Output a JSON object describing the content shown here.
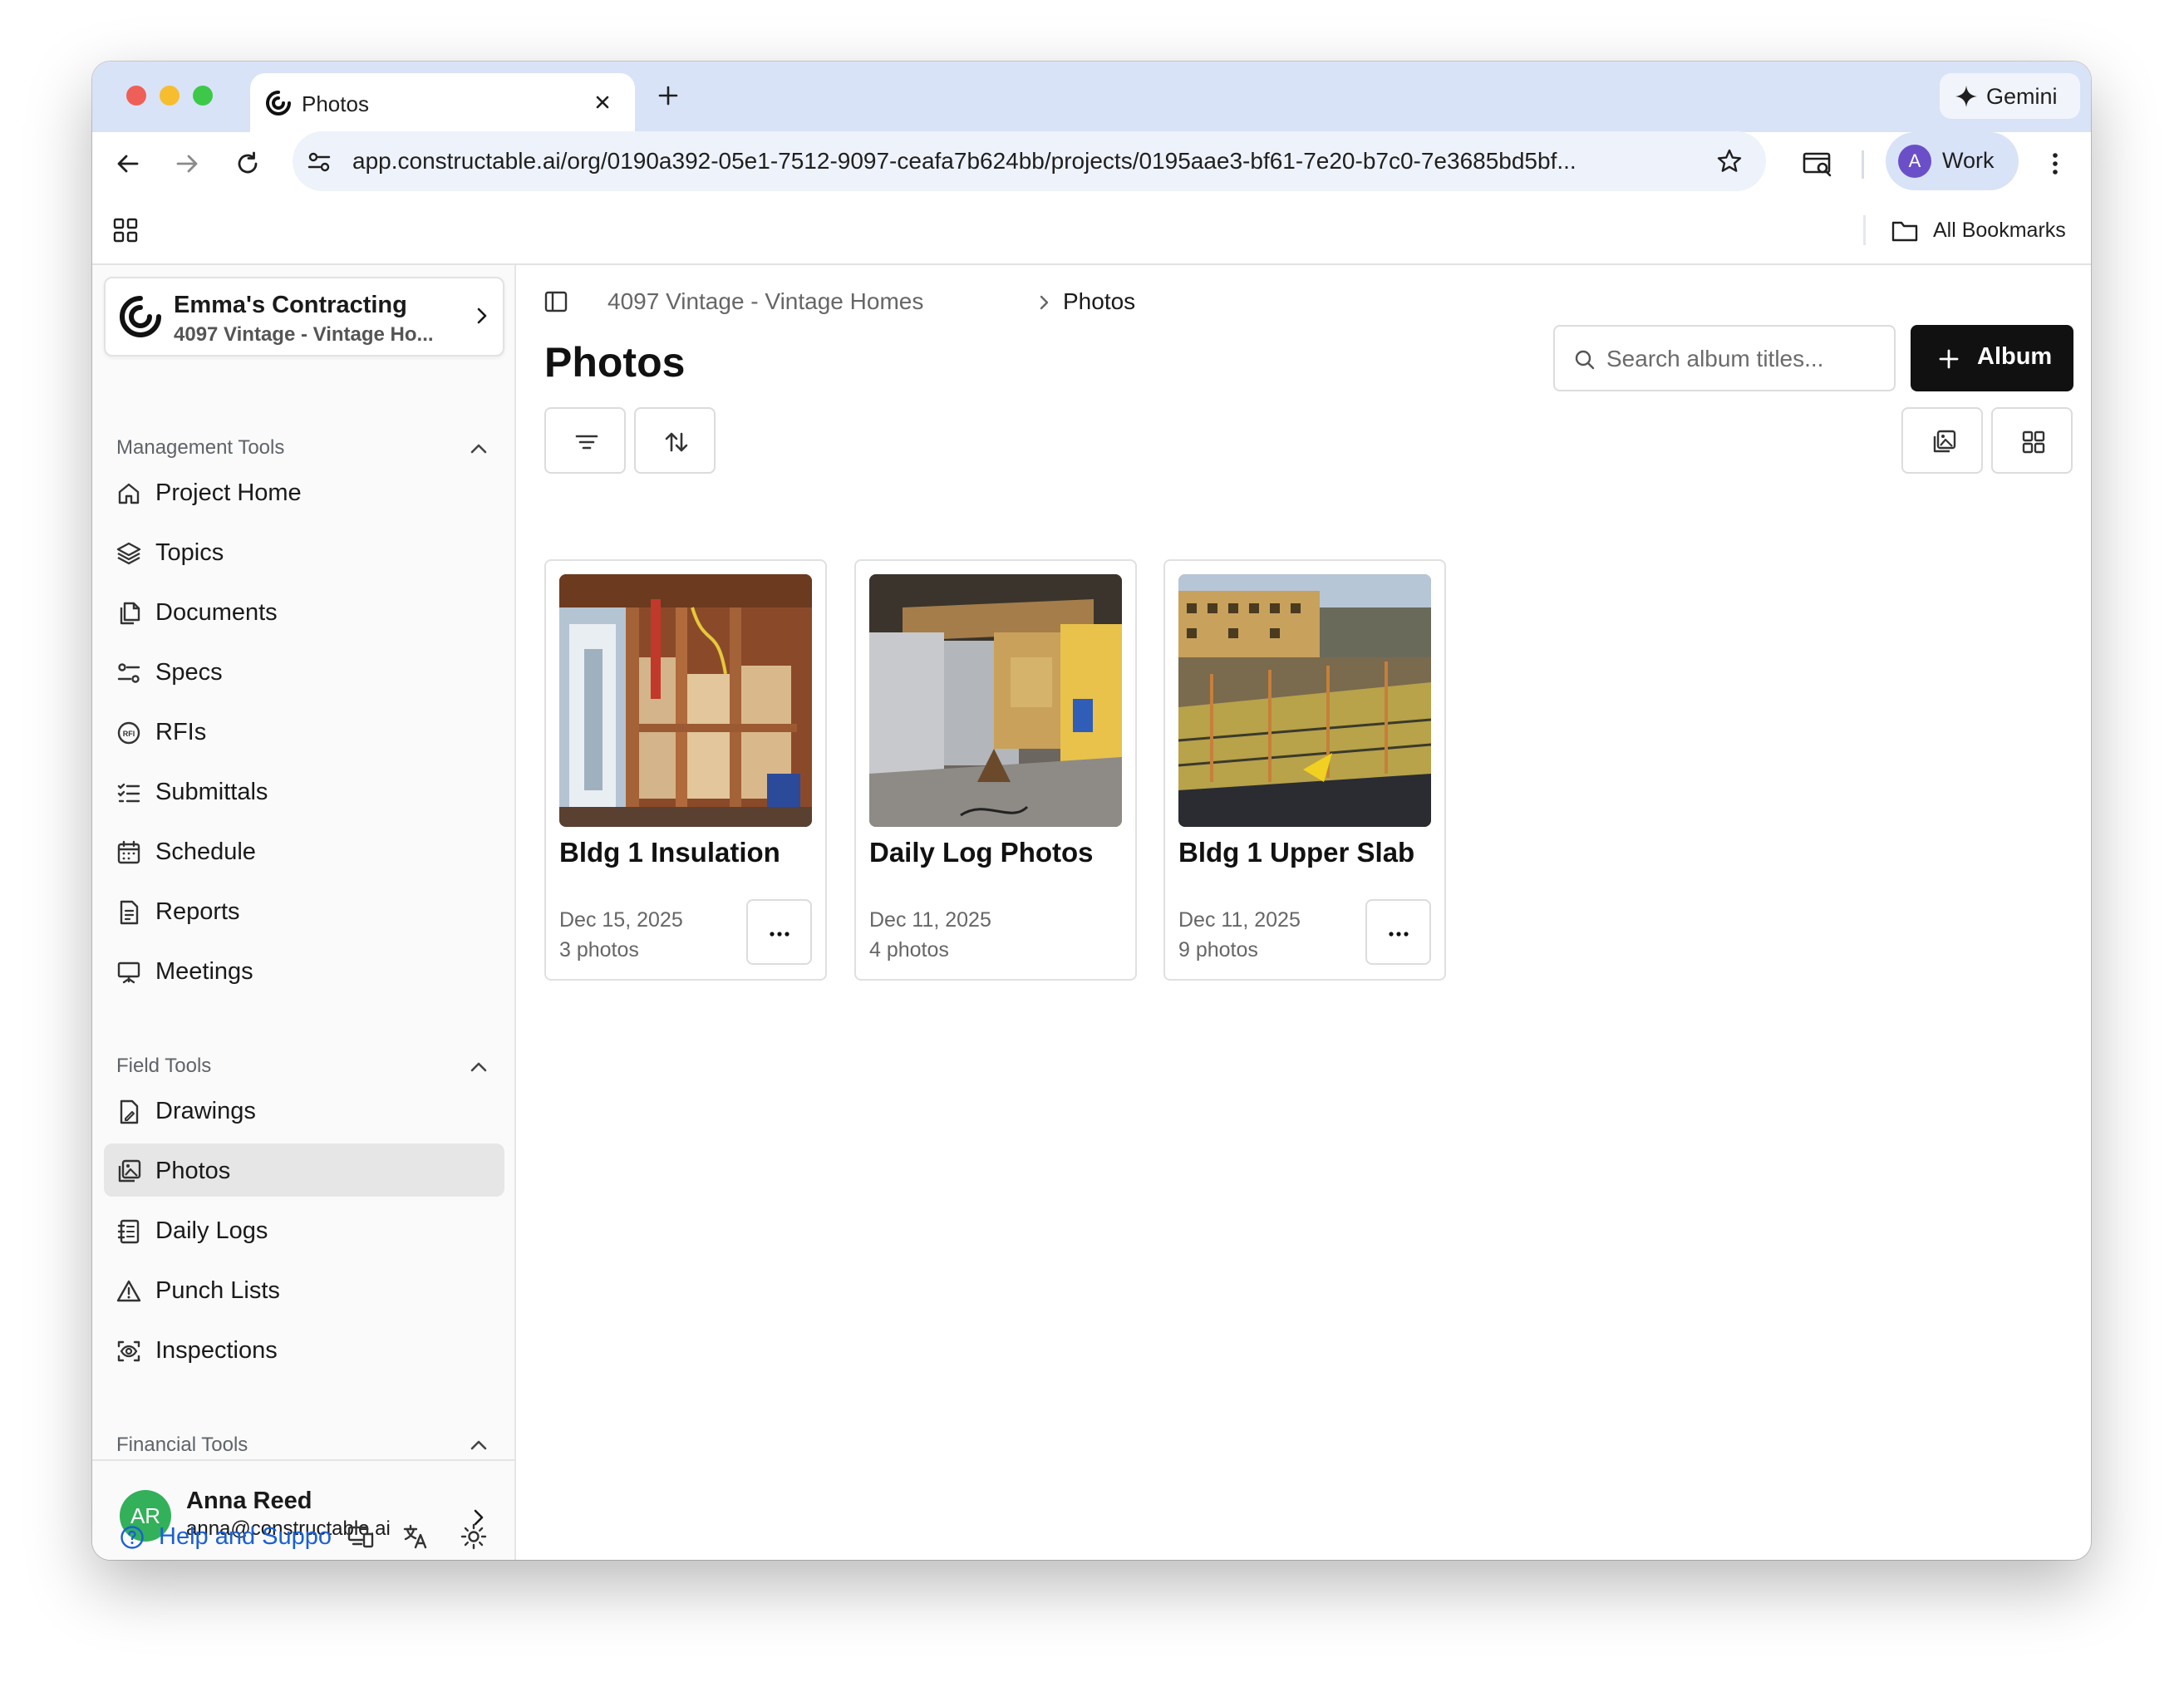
{
  "browser": {
    "tab_title": "Photos",
    "gemini_label": "Gemini",
    "url": "app.constructable.ai/org/0190a392-05e1-7512-9097-ceafa7b624bb/projects/0195aae3-bf61-7e20-b7c0-7e3685bd5bf...",
    "profile_initial": "A",
    "profile_label": "Work",
    "bookmarks_label": "All Bookmarks"
  },
  "sidebar": {
    "org_name": "Emma's Contracting",
    "project_name": "4097 Vintage - Vintage Ho...",
    "sections": {
      "management": {
        "title": "Management Tools",
        "items": [
          {
            "label": "Project Home",
            "icon": "home-icon"
          },
          {
            "label": "Topics",
            "icon": "layers-icon"
          },
          {
            "label": "Documents",
            "icon": "documents-icon"
          },
          {
            "label": "Specs",
            "icon": "specs-icon"
          },
          {
            "label": "RFIs",
            "icon": "rfi-icon"
          },
          {
            "label": "Submittals",
            "icon": "checklist-icon"
          },
          {
            "label": "Schedule",
            "icon": "calendar-icon"
          },
          {
            "label": "Reports",
            "icon": "report-icon"
          },
          {
            "label": "Meetings",
            "icon": "presentation-icon"
          }
        ]
      },
      "field": {
        "title": "Field Tools",
        "items": [
          {
            "label": "Drawings",
            "icon": "drawing-icon"
          },
          {
            "label": "Photos",
            "icon": "photos-icon",
            "active": true
          },
          {
            "label": "Daily Logs",
            "icon": "logbook-icon"
          },
          {
            "label": "Punch Lists",
            "icon": "warning-icon"
          },
          {
            "label": "Inspections",
            "icon": "inspection-icon"
          }
        ]
      },
      "financial": {
        "title": "Financial Tools"
      }
    },
    "user": {
      "initials": "AR",
      "name": "Anna Reed",
      "email": "anna@constructable.ai"
    },
    "help_label": "Help and Suppo"
  },
  "main": {
    "breadcrumb": {
      "project": "4097 Vintage - Vintage Homes",
      "current": "Photos"
    },
    "title": "Photos",
    "search_placeholder": "Search album titles...",
    "album_button": "Album",
    "albums": [
      {
        "title": "Bldg 1 Insulation",
        "date": "Dec 15, 2025",
        "count": "3 photos",
        "has_menu": true
      },
      {
        "title": "Daily Log Photos",
        "date": "Dec 11, 2025",
        "count": "4 photos",
        "has_menu": false
      },
      {
        "title": "Bldg 1 Upper Slab",
        "date": "Dec 11, 2025",
        "count": "9 photos",
        "has_menu": true
      }
    ]
  },
  "colors": {
    "tabstrip": "#d9e3f7",
    "primary_button": "#111111",
    "link": "#1a5fd6",
    "avatar_user": "#33b05a",
    "avatar_profile": "#6b4fc8"
  }
}
